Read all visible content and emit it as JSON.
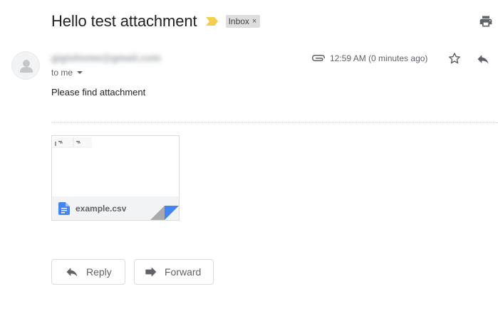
{
  "message": {
    "subject": "Hello test attachment",
    "label": "Inbox",
    "label_close_glyph": "×",
    "sender_obscured": "gigiohome@gmail.com",
    "recipient_text": "to me",
    "time": "12:59 AM (0 minutes ago)",
    "body": "Please find attachment"
  },
  "attachment": {
    "filename": "example.csv",
    "icon": "docs-file-icon"
  },
  "actions": {
    "reply_label": "Reply",
    "forward_label": "Forward"
  },
  "icons": {
    "importance": "importance-marker-icon",
    "print": "print-icon",
    "avatar": "default-avatar-icon",
    "attachment": "paperclip-icon",
    "star": "star-icon",
    "reply": "reply-icon",
    "forward": "forward-icon"
  },
  "colors": {
    "importance_marker": "#f4cd4e",
    "docs_blue": "#4285f4",
    "label_chip": "#dddddd",
    "muted_text": "#5f6368"
  }
}
